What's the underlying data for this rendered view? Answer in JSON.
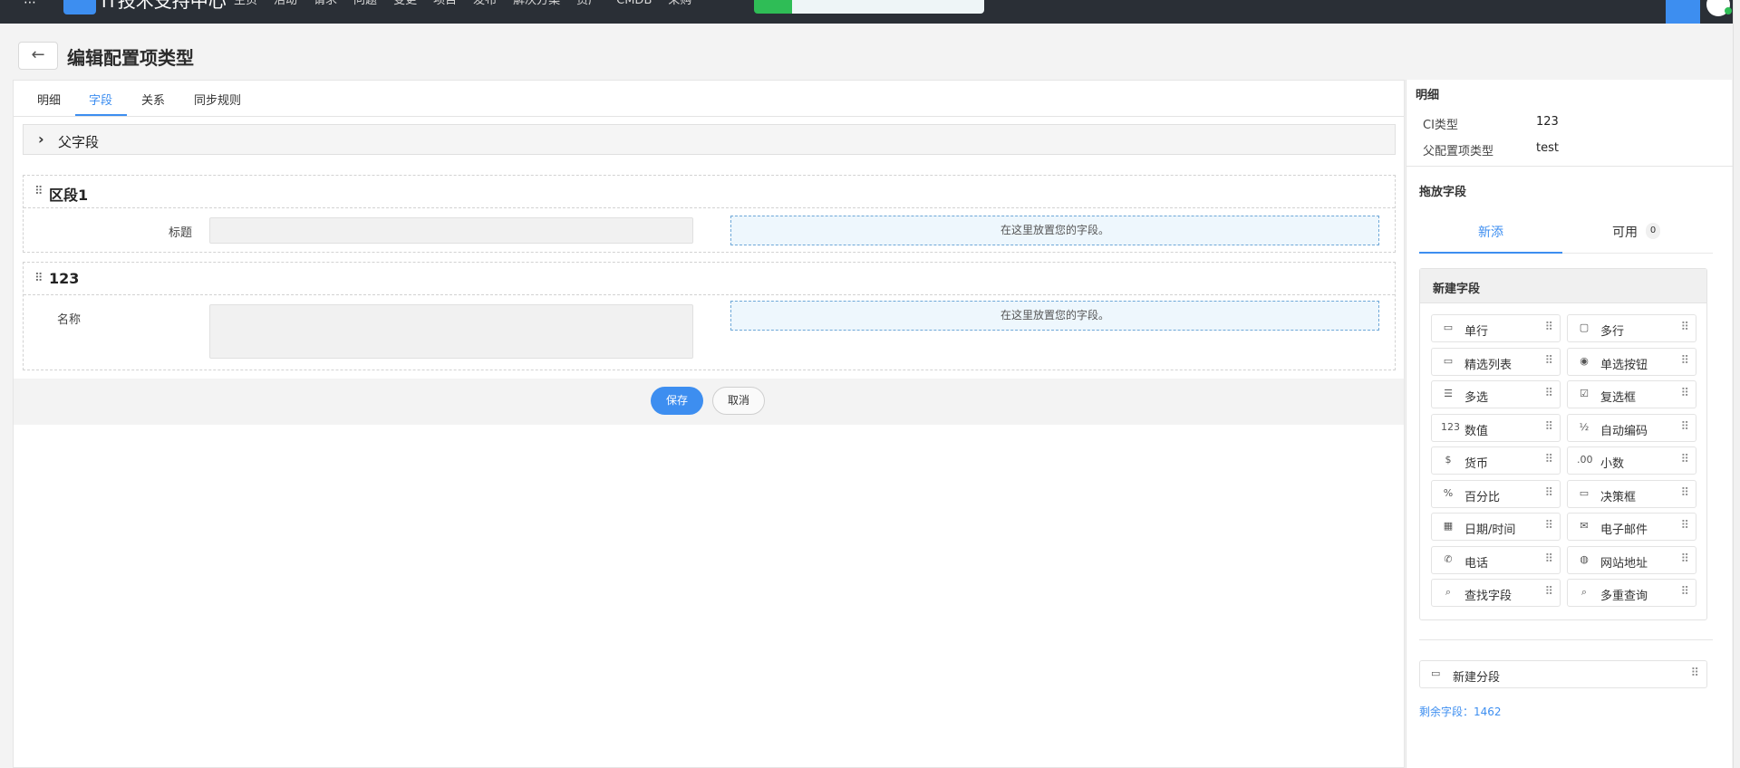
{
  "topnav": {
    "brand": "IT技术支持中心",
    "menu": [
      "主页",
      "活动",
      "请求",
      "问题",
      "变更",
      "项目",
      "发布",
      "解决方案",
      "资产",
      "CMDB",
      "采购"
    ],
    "icons": [
      "search-icon",
      "gear-outline-icon",
      "lightning-icon",
      "clock-icon",
      "note-icon",
      "bell-icon",
      "gear-icon",
      "avatar"
    ]
  },
  "page": {
    "title": "编辑配置项类型",
    "back_symbol": "←"
  },
  "tabs": [
    "明细",
    "字段",
    "关系",
    "同步规则"
  ],
  "active_tab": "字段",
  "parent_field": {
    "label": "父字段",
    "chevron": "›"
  },
  "sections": [
    {
      "name": "区段1",
      "field_label": "标题",
      "drop_text": "在这里放置您的字段。"
    },
    {
      "name": "123",
      "field_label": "名称",
      "drop_text": "在这里放置您的字段。"
    }
  ],
  "buttons": {
    "save": "保存",
    "cancel": "取消"
  },
  "details": {
    "title": "明细",
    "rows": [
      {
        "key": "CI类型",
        "value": "123"
      },
      {
        "key": "父配置项类型",
        "value": "test"
      }
    ]
  },
  "drag_panel": {
    "title": "拖放字段",
    "tabs": {
      "new": "新添",
      "available": "可用",
      "available_count": "0"
    },
    "new_field_title": "新建字段",
    "items": [
      {
        "label": "单行",
        "icon": "▭"
      },
      {
        "label": "多行",
        "icon": "▢"
      },
      {
        "label": "精选列表",
        "icon": "▭"
      },
      {
        "label": "单选按钮",
        "icon": "◉"
      },
      {
        "label": "多选",
        "icon": "☰"
      },
      {
        "label": "复选框",
        "icon": "☑"
      },
      {
        "label": "数值",
        "icon": "123"
      },
      {
        "label": "自动编码",
        "icon": "½"
      },
      {
        "label": "货币",
        "icon": "$"
      },
      {
        "label": "小数",
        "icon": ".00"
      },
      {
        "label": "百分比",
        "icon": "%"
      },
      {
        "label": "决策框",
        "icon": "▭"
      },
      {
        "label": "日期/时间",
        "icon": "▦"
      },
      {
        "label": "电子邮件",
        "icon": "✉"
      },
      {
        "label": "电话",
        "icon": "✆"
      },
      {
        "label": "网站地址",
        "icon": "◍"
      },
      {
        "label": "查找字段",
        "icon": "⌕"
      },
      {
        "label": "多重查询",
        "icon": "⌕"
      }
    ],
    "new_section": "新建分段",
    "remaining": "剩余字段：1462"
  }
}
